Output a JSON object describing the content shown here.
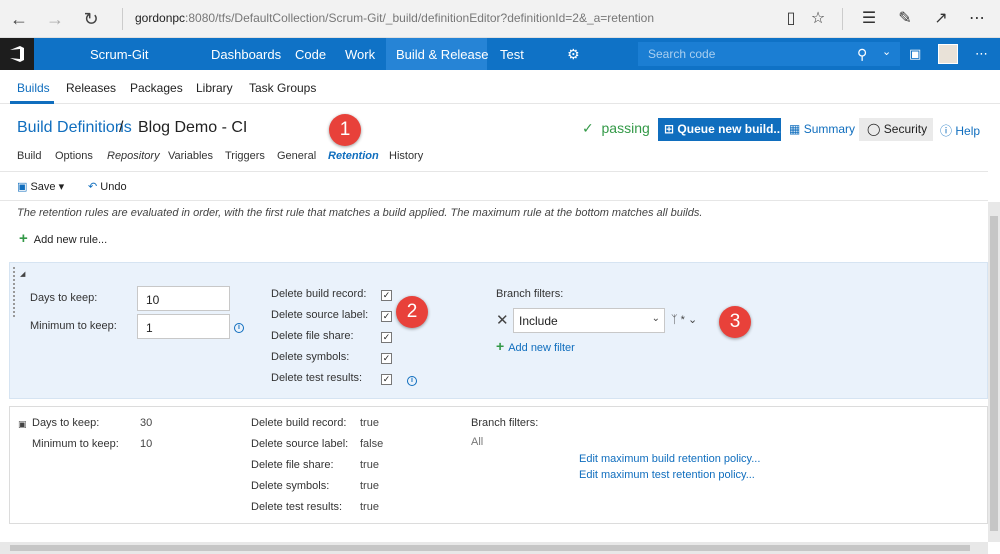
{
  "browser": {
    "address_host": "gordonpc",
    "address_rest": ":8080/tfs/DefaultCollection/Scrum-Git/_build/definitionEditor?definitionId=2&_a=retention"
  },
  "topnav": {
    "project": "Scrum-Git",
    "hubs": [
      "Dashboards",
      "Code",
      "Work",
      "Build & Release",
      "Test"
    ],
    "active_hub": "Build & Release",
    "search_placeholder": "Search code"
  },
  "subnav": {
    "items": [
      "Builds",
      "Releases",
      "Packages",
      "Library",
      "Task Groups"
    ],
    "active": "Builds"
  },
  "header": {
    "breadcrumb": "Build Definitions",
    "separator": "/",
    "definition_name": "Blog Demo - CI",
    "status": "passing",
    "queue_button": "Queue new build...",
    "summary_link": "Summary",
    "security_button": "Security",
    "help_link": "Help"
  },
  "tabs": [
    "Build",
    "Options",
    "Repository",
    "Variables",
    "Triggers",
    "General",
    "Retention",
    "History"
  ],
  "active_tab": "Retention",
  "toolbar": {
    "save": "Save",
    "undo": "Undo"
  },
  "info_text": "The retention rules are evaluated in order, with the first rule that matches a build applied. The maximum rule at the bottom matches all builds.",
  "add_rule": "Add new rule...",
  "rule1": {
    "days_label": "Days to keep:",
    "days_value": "10",
    "min_label": "Minimum to keep:",
    "min_value": "1",
    "checks": [
      {
        "label": "Delete build record:",
        "checked": true
      },
      {
        "label": "Delete source label:",
        "checked": true
      },
      {
        "label": "Delete file share:",
        "checked": true
      },
      {
        "label": "Delete symbols:",
        "checked": true
      },
      {
        "label": "Delete test results:",
        "checked": true
      }
    ],
    "branch_filters_label": "Branch filters:",
    "filter_type": "Include",
    "filter_branch": "*",
    "add_filter": "Add new filter"
  },
  "rule2": {
    "days_label": "Days to keep:",
    "days_value": "30",
    "min_label": "Minimum to keep:",
    "min_value": "10",
    "fields": [
      {
        "label": "Delete build record:",
        "value": "true"
      },
      {
        "label": "Delete source label:",
        "value": "false"
      },
      {
        "label": "Delete file share:",
        "value": "true"
      },
      {
        "label": "Delete symbols:",
        "value": "true"
      },
      {
        "label": "Delete test results:",
        "value": "true"
      }
    ],
    "branch_filters_label": "Branch filters:",
    "branch_filters_value": "All",
    "edit_build_link": "Edit maximum build retention policy...",
    "edit_test_link": "Edit maximum test retention policy..."
  },
  "markers": [
    "1",
    "2",
    "3"
  ],
  "colors": {
    "accent": "#106ebe",
    "topnav": "#0f72c6",
    "marker": "#e8413a",
    "passing": "#339947"
  }
}
